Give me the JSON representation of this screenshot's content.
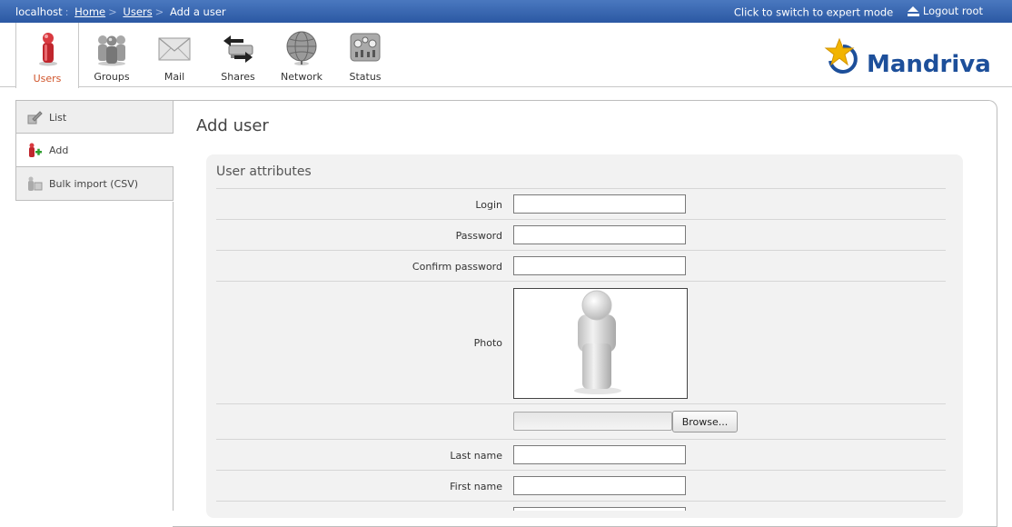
{
  "topbar": {
    "host": "localhost",
    "crumbs": [
      "Home",
      "Users"
    ],
    "current": "Add a user",
    "expert_mode": "Click to switch to expert mode",
    "logout": "Logout root"
  },
  "modules": [
    {
      "label": "Users",
      "icon": "users-icon",
      "active": true
    },
    {
      "label": "Groups",
      "icon": "groups-icon"
    },
    {
      "label": "Mail",
      "icon": "mail-icon"
    },
    {
      "label": "Shares",
      "icon": "shares-icon"
    },
    {
      "label": "Network",
      "icon": "network-icon"
    },
    {
      "label": "Status",
      "icon": "status-icon"
    }
  ],
  "brand": "Mandriva",
  "sidenav": [
    {
      "label": "List",
      "icon": "list-icon"
    },
    {
      "label": "Add",
      "icon": "add-user-icon",
      "active": true
    },
    {
      "label": "Bulk import (CSV)",
      "icon": "bulk-import-icon"
    }
  ],
  "page_title": "Add user",
  "form": {
    "section_title": "User attributes",
    "login_label": "Login",
    "login_value": "",
    "password_label": "Password",
    "password_value": "",
    "confirm_label": "Confirm password",
    "confirm_value": "",
    "photo_label": "Photo",
    "browse_label": "Browse...",
    "lastname_label": "Last name",
    "lastname_value": "",
    "firstname_label": "First name",
    "firstname_value": ""
  },
  "colors": {
    "topbar": "#2b58a3",
    "active_module_label": "#d0542a",
    "brand_blue": "#1d4f9a",
    "brand_star": "#f2b400"
  }
}
